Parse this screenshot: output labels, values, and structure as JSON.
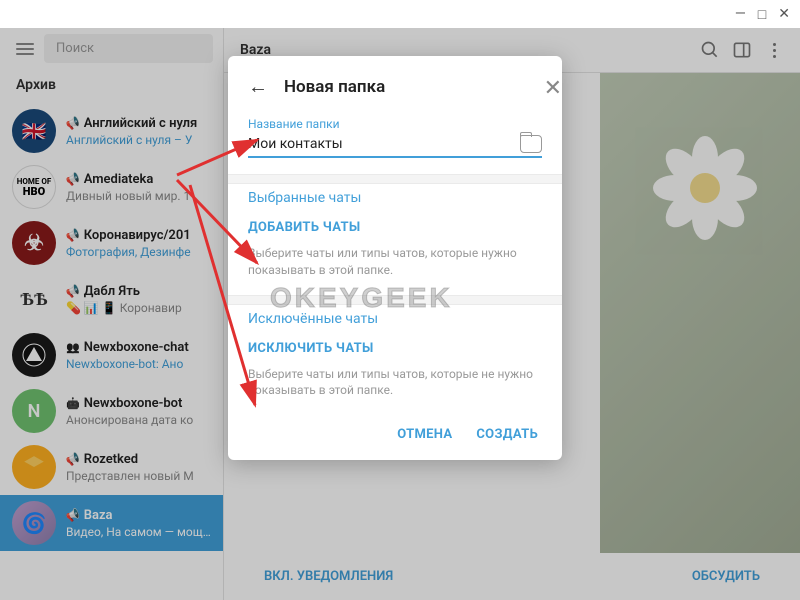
{
  "window": {
    "title": "Baza"
  },
  "search": {
    "placeholder": "Поиск"
  },
  "archive_label": "Архив",
  "chats": [
    {
      "title": "Английский с нуля",
      "sub": "Английский с нуля – У",
      "sub_link": true,
      "icon": "megaphone",
      "avatar_bg": "#1a4a7a",
      "avatar_flag": true
    },
    {
      "title": "Amediateka",
      "sub": "Дивный новый мир. 1",
      "icon": "megaphone",
      "avatar_bg": "#fff",
      "avatar_hbo": true
    },
    {
      "title": "Коронавирус/201",
      "sub": "Фотография, Дезинфе",
      "sub_link": true,
      "icon": "megaphone",
      "avatar_bg": "#8a1a1a",
      "avatar_bio": true
    },
    {
      "title": "Дабл Ять",
      "sub": "💊 📊 📱 Коронавир",
      "icon": "megaphone",
      "avatar_bg": "#fff",
      "avatar_text": "ѢѢ"
    },
    {
      "title": "Newxboxone-chat",
      "sub": "Newxboxone-bot: Ано",
      "sub_link": true,
      "icon": "users",
      "avatar_bg": "#1a1a1a",
      "avatar_tri": true
    },
    {
      "title": "Newxboxone-bot",
      "sub": "Анонсирована дата ко",
      "icon": "bot",
      "avatar_bg": "#70c270",
      "avatar_letter": "N"
    },
    {
      "title": "Rozetked",
      "sub": "Представлен новый M",
      "icon": "megaphone",
      "avatar_bg": "#ffb020",
      "avatar_cube": true
    },
    {
      "title": "Baza",
      "sub": "Видео, На самом — мощная",
      "icon": "megaphone",
      "avatar_bg": "#b090c0",
      "avatar_baza": true,
      "active": true
    }
  ],
  "main": {
    "footer_left": "ВКЛ. УВЕДОМЛЕНИЯ",
    "footer_right": "ОБСУДИТЬ"
  },
  "modal": {
    "title": "Новая папка",
    "field_label": "Название папки",
    "field_value": "Мои контакты",
    "section1": {
      "header": "Выбранные чаты",
      "action": "ДОБАВИТЬ ЧАТЫ",
      "hint": "Выберите чаты или типы чатов, которые нужно показывать в этой папке."
    },
    "section2": {
      "header": "Исключённые чаты",
      "action": "ИСКЛЮЧИТЬ ЧАТЫ",
      "hint": "Выберите чаты или типы чатов, которые не нужно показывать в этой папке."
    },
    "cancel": "ОТМЕНА",
    "create": "СОЗДАТЬ"
  },
  "watermark": "OKEYGEEK"
}
